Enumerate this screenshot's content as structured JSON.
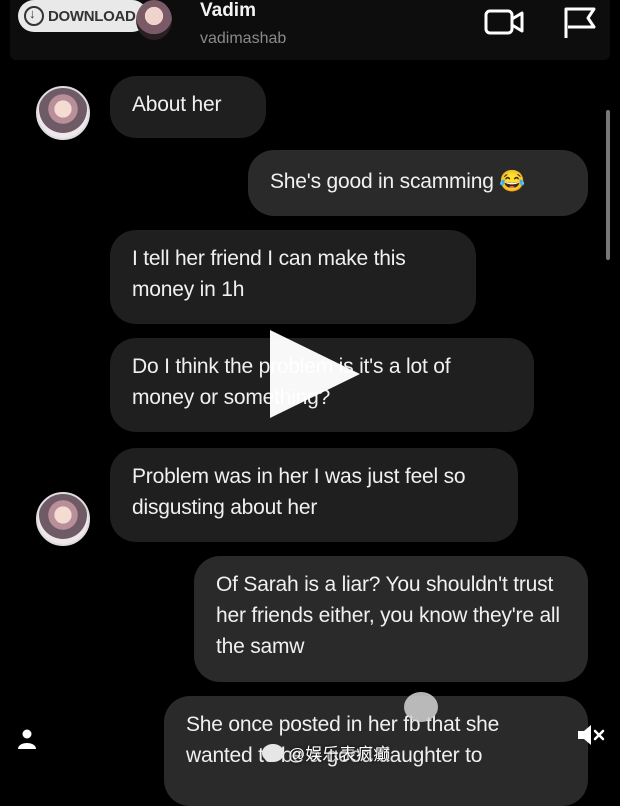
{
  "header": {
    "download_label": "DOWNLOAD",
    "contact_name": "Vadim",
    "contact_username": "vadimashab"
  },
  "messages": [
    {
      "side": "in",
      "text": "About her",
      "avatar": true
    },
    {
      "side": "out",
      "text": "She's good in scamming 😂",
      "avatar": false
    },
    {
      "side": "in",
      "text": "I tell her friend I can make this money in 1h",
      "avatar": false
    },
    {
      "side": "in",
      "text": "Do I think the problem is it's a lot of money or something?",
      "avatar": false
    },
    {
      "side": "in",
      "text": "Problem was in her I was just feel so disgusting about her",
      "avatar": true
    },
    {
      "side": "out",
      "text": "Of Sarah is a liar? You shouldn't trust her friends either, you know they're all the samw",
      "avatar": false
    },
    {
      "side": "out",
      "text": "She once posted in her fb that she wanted to be a good daughter to",
      "avatar": false
    }
  ],
  "watermark": "@娱乐表疯癫",
  "icons": {
    "video_call": "video-camera-icon",
    "report": "flag-icon",
    "play": "play-icon",
    "profile": "person-icon",
    "mute": "volume-muted-icon"
  }
}
